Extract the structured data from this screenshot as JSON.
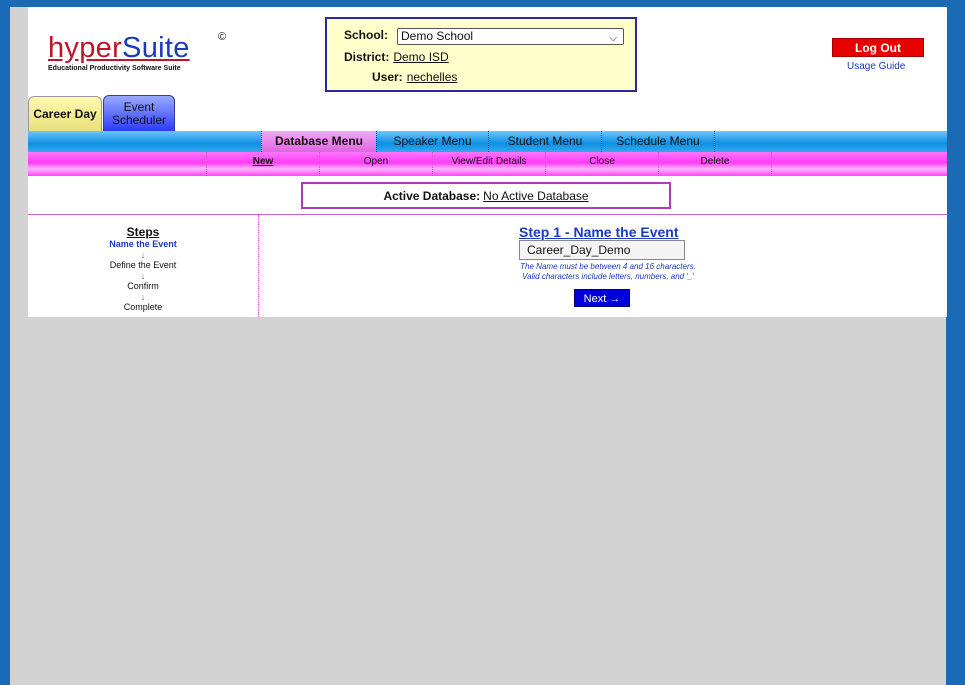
{
  "logo": {
    "hyper": "hyper",
    "suite": "Suite",
    "copyright": "©",
    "tagline": "Educational Productivity Software Suite"
  },
  "selector": {
    "school_label": "School:",
    "school_value": "Demo School",
    "district_label": "District:",
    "district_value": "Demo ISD",
    "user_label": "User:",
    "user_value": "nechelles"
  },
  "header": {
    "logout_label": "Log Out",
    "usage_guide": "Usage Guide"
  },
  "tabs": [
    {
      "label": "Career Day"
    },
    {
      "label": "Event Scheduler"
    }
  ],
  "menu": {
    "items": [
      "Database Menu",
      "Speaker Menu",
      "Student Menu",
      "Schedule Menu"
    ],
    "active": "Database Menu"
  },
  "submenu": {
    "items": [
      "New",
      "Open",
      "View/Edit Details",
      "Close",
      "Delete"
    ],
    "active": "New"
  },
  "active_db": {
    "label": "Active Database:",
    "value": "No Active Database"
  },
  "steps": {
    "title": "Steps",
    "list": [
      "Name the Event",
      "Define the Event",
      "Confirm",
      "Complete"
    ],
    "current": "Name the Event",
    "arrow": "↓"
  },
  "step1": {
    "title": "Step 1 - Name the Event",
    "input_value": "Career_Day_Demo",
    "hint1": "The Name must be between 4 and 16 characters.",
    "hint2": "Valid characters include letters, numbers, and '_'",
    "next_label": "Next →"
  },
  "colors": {
    "frame": "#1a6bb5",
    "logout": "#e60000",
    "link": "#1a3bbf",
    "magenta": "#d05fd6"
  }
}
